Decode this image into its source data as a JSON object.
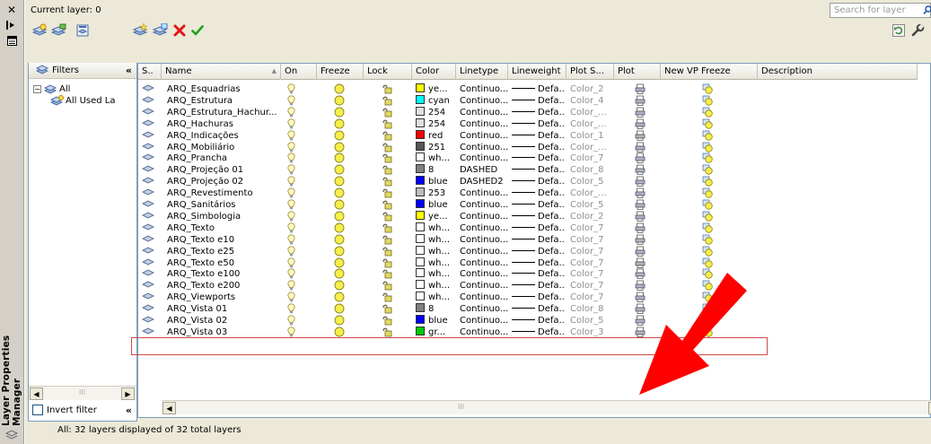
{
  "window": {
    "title": "Layer Properties Manager",
    "close_glyph": "✕"
  },
  "header": {
    "current_layer_label": "Current layer: 0",
    "search_placeholder": "Search for layer"
  },
  "filters": {
    "title": "Filters",
    "collapse": "«",
    "tree": [
      {
        "label": "All"
      },
      {
        "label": "All Used La"
      }
    ],
    "invert_filter_label": "Invert filter",
    "scroll_mid": "III"
  },
  "columns": [
    "S..",
    "Name",
    "On",
    "Freeze",
    "Lock",
    "Color",
    "Linetype",
    "Lineweight",
    "Plot S...",
    "Plot",
    "New VP Freeze",
    "Description"
  ],
  "layers": [
    {
      "name": "ARQ_Esquadrias",
      "color_hex": "#ffff00",
      "color": "ye...",
      "linetype": "Continuo...",
      "lineweight": "Defa...",
      "plotstyle": "Color_2"
    },
    {
      "name": "ARQ_Estrutura",
      "color_hex": "#00ffff",
      "color": "cyan",
      "linetype": "Continuo...",
      "lineweight": "Defa...",
      "plotstyle": "Color_4"
    },
    {
      "name": "ARQ_Estrutura_Hachur...",
      "color_hex": "#e0e0e0",
      "color": "254",
      "linetype": "Continuo...",
      "lineweight": "Defa...",
      "plotstyle": "Color_..."
    },
    {
      "name": "ARQ_Hachuras",
      "color_hex": "#e0e0e0",
      "color": "254",
      "linetype": "Continuo...",
      "lineweight": "Defa...",
      "plotstyle": "Color_..."
    },
    {
      "name": "ARQ_Indicações",
      "color_hex": "#ff0000",
      "color": "red",
      "linetype": "Continuo...",
      "lineweight": "Defa...",
      "plotstyle": "Color_1"
    },
    {
      "name": "ARQ_Mobiliário",
      "color_hex": "#555555",
      "color": "251",
      "linetype": "Continuo...",
      "lineweight": "Defa...",
      "plotstyle": "Color_..."
    },
    {
      "name": "ARQ_Prancha",
      "color_hex": "#ffffff",
      "color": "wh...",
      "linetype": "Continuo...",
      "lineweight": "Defa...",
      "plotstyle": "Color_7"
    },
    {
      "name": "ARQ_Projeção 01",
      "color_hex": "#808080",
      "color": "8",
      "linetype": "DASHED",
      "lineweight": "Defa...",
      "plotstyle": "Color_8"
    },
    {
      "name": "ARQ_Projeção 02",
      "color_hex": "#0000ff",
      "color": "blue",
      "linetype": "DASHED2",
      "lineweight": "Defa...",
      "plotstyle": "Color_5"
    },
    {
      "name": "ARQ_Revestimento",
      "color_hex": "#bdbdbd",
      "color": "253",
      "linetype": "Continuo...",
      "lineweight": "Defa...",
      "plotstyle": "Color_..."
    },
    {
      "name": "ARQ_Sanitários",
      "color_hex": "#0000ff",
      "color": "blue",
      "linetype": "Continuo...",
      "lineweight": "Defa...",
      "plotstyle": "Color_5"
    },
    {
      "name": "ARQ_Simbologia",
      "color_hex": "#ffff00",
      "color": "ye...",
      "linetype": "Continuo...",
      "lineweight": "Defa...",
      "plotstyle": "Color_2"
    },
    {
      "name": "ARQ_Texto",
      "color_hex": "#ffffff",
      "color": "wh...",
      "linetype": "Continuo...",
      "lineweight": "Defa...",
      "plotstyle": "Color_7"
    },
    {
      "name": "ARQ_Texto e10",
      "color_hex": "#ffffff",
      "color": "wh...",
      "linetype": "Continuo...",
      "lineweight": "Defa...",
      "plotstyle": "Color_7"
    },
    {
      "name": "ARQ_Texto e25",
      "color_hex": "#ffffff",
      "color": "wh...",
      "linetype": "Continuo...",
      "lineweight": "Defa...",
      "plotstyle": "Color_7"
    },
    {
      "name": "ARQ_Texto e50",
      "color_hex": "#ffffff",
      "color": "wh...",
      "linetype": "Continuo...",
      "lineweight": "Defa...",
      "plotstyle": "Color_7"
    },
    {
      "name": "ARQ_Texto e100",
      "color_hex": "#ffffff",
      "color": "wh...",
      "linetype": "Continuo...",
      "lineweight": "Defa...",
      "plotstyle": "Color_7"
    },
    {
      "name": "ARQ_Texto e200",
      "color_hex": "#ffffff",
      "color": "wh...",
      "linetype": "Continuo...",
      "lineweight": "Defa...",
      "plotstyle": "Color_7"
    },
    {
      "name": "ARQ_Viewports",
      "color_hex": "#ffffff",
      "color": "wh...",
      "linetype": "Continuo...",
      "lineweight": "Defa...",
      "plotstyle": "Color_7",
      "selected": true
    },
    {
      "name": "ARQ_Vista 01",
      "color_hex": "#808080",
      "color": "8",
      "linetype": "Continuo...",
      "lineweight": "Defa...",
      "plotstyle": "Color_8"
    },
    {
      "name": "ARQ_Vista 02",
      "color_hex": "#0000ff",
      "color": "blue",
      "linetype": "Continuo...",
      "lineweight": "Defa...",
      "plotstyle": "Color_5"
    },
    {
      "name": "ARQ_Vista 03",
      "color_hex": "#00cc00",
      "color": "gr...",
      "linetype": "Continuo...",
      "lineweight": "Defa...",
      "plotstyle": "Color_3"
    }
  ],
  "list_scroll_mid": "III",
  "status": {
    "text": "All: 32 layers displayed of 32 total layers"
  },
  "colors": {
    "panel_bg": "#ece9d8",
    "border": "#7f9db9",
    "selection": "#d04848",
    "annotation_arrow": "#ff0000",
    "plotstyle_gray": "#8f8f8f"
  }
}
